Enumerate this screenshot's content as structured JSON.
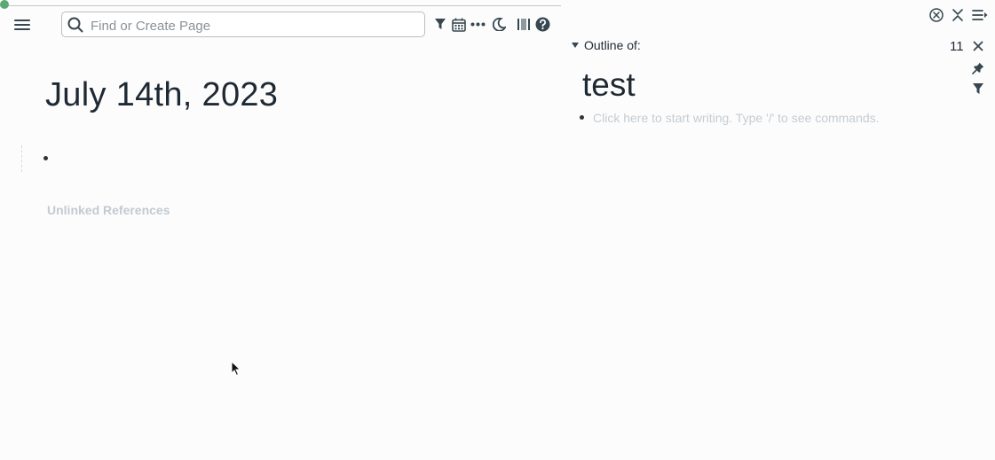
{
  "left_panel": {
    "search": {
      "placeholder": "Find or Create Page",
      "value": ""
    },
    "page_title": "July 14th, 2023",
    "unlinked_references_label": "Unlinked References",
    "status_color": "#5aa872",
    "toolbar_icons": [
      "filter-icon",
      "calendar-icon",
      "more-icon",
      "moon-icon",
      "sidebar-toggle-icon",
      "help-icon"
    ]
  },
  "right_panel": {
    "outline_label": "Outline of:",
    "count": "11",
    "title": "test",
    "placeholder": "Click here to start writing. Type '/' to see commands.",
    "icons": [
      "close-all-icon",
      "collapse-all-icon",
      "menu-icon",
      "close-icon",
      "pin-icon",
      "filter-icon"
    ]
  }
}
